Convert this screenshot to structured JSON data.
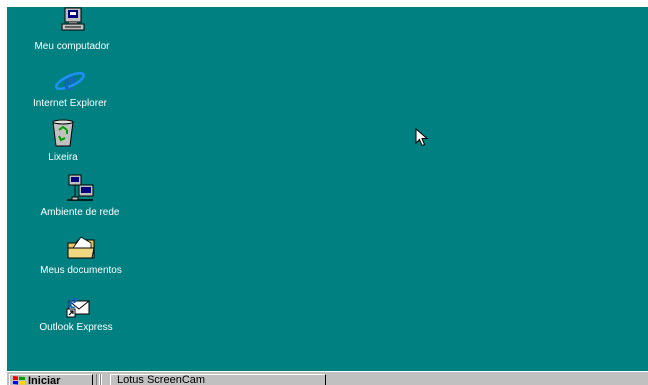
{
  "desktop": {
    "background_color": "#008080",
    "icons": [
      {
        "label": "Meu computador",
        "icon": "my-computer-icon"
      },
      {
        "label": "Internet Explorer",
        "icon": "internet-explorer-icon"
      },
      {
        "label": "Lixeira",
        "icon": "recycle-bin-icon"
      },
      {
        "label": "Ambiente de rede",
        "icon": "network-neighborhood-icon"
      },
      {
        "label": "Meus documentos",
        "icon": "my-documents-icon"
      },
      {
        "label": "Outlook Express",
        "icon": "outlook-express-icon"
      }
    ]
  },
  "taskbar": {
    "start_label": "Iniciar",
    "tasks": [
      {
        "label": "Lotus ScreenCam"
      }
    ]
  }
}
